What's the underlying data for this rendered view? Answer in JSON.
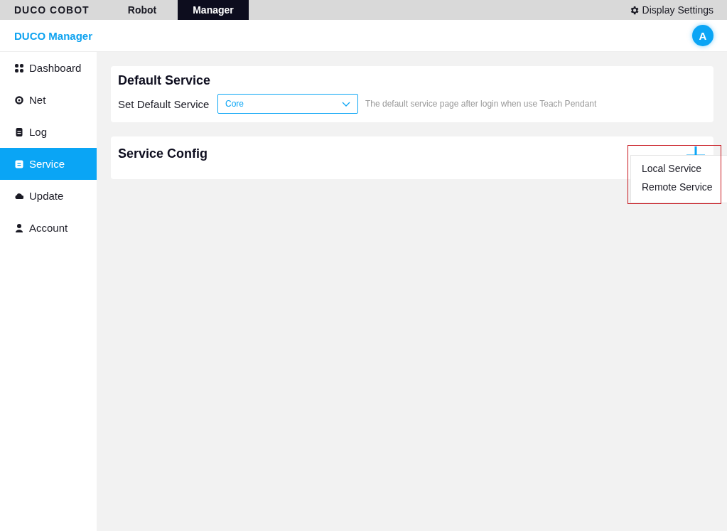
{
  "top_bar": {
    "logo": "DUCO COBOT",
    "tabs": [
      {
        "label": "Robot",
        "selected": false
      },
      {
        "label": "Manager",
        "selected": true
      }
    ],
    "settings": "Display Settings"
  },
  "header": {
    "title": "DUCO Manager",
    "avatar": "A"
  },
  "sidebar": {
    "items": [
      {
        "label": "Dashboard",
        "selected": false
      },
      {
        "label": "Net",
        "selected": false
      },
      {
        "label": "Log",
        "selected": false
      },
      {
        "label": "Service",
        "selected": true
      },
      {
        "label": "Update",
        "selected": false
      },
      {
        "label": "Account",
        "selected": false
      }
    ]
  },
  "default_service": {
    "title": "Default Service",
    "label": "Set Default Service",
    "value": "Core",
    "hint": "The default service page after login when use Teach Pendant"
  },
  "service_config": {
    "title": "Service Config",
    "menu": [
      "Local Service",
      "Remote Service"
    ]
  }
}
